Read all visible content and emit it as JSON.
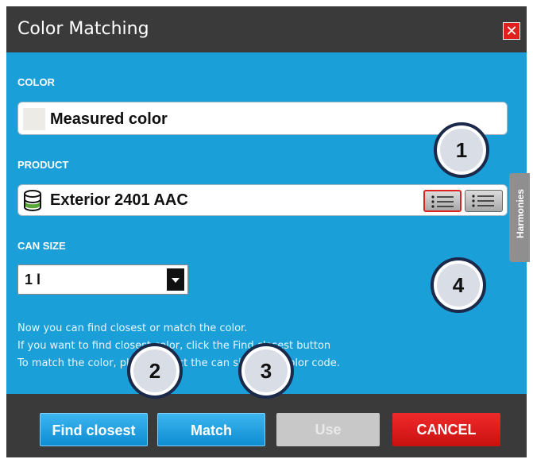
{
  "dialog": {
    "title": "Color Matching",
    "close_glyph": "✕"
  },
  "color_section": {
    "label": "COLOR",
    "value": "Measured color",
    "swatch_color": "#ecebe6"
  },
  "product_section": {
    "label": "PRODUCT",
    "value": "Exterior 2401 AAC",
    "icon": "paint-can-icon",
    "list_buttons": [
      "list-icon",
      "list-icon"
    ]
  },
  "can_size_section": {
    "label": "CAN SIZE",
    "value": "1 l"
  },
  "side_tab": {
    "label": "Harmonies"
  },
  "help_text": {
    "line1": "Now you can find closest or match the color.",
    "line2": "If you want to find closest color, click the Find closest button",
    "line3": "To match the color, please select the can size then color code."
  },
  "buttons": {
    "find_closest": "Find closest",
    "match": "Match",
    "use": "Use",
    "cancel": "CANCEL"
  },
  "callouts": [
    "1",
    "2",
    "3",
    "4"
  ],
  "colors": {
    "dialog_blue": "#1a9fd8",
    "bar_dark": "#3a3a3a",
    "close_red": "#e0201c",
    "cancel_red": "#e01a1a",
    "disabled_gray": "#c8c8c8"
  }
}
